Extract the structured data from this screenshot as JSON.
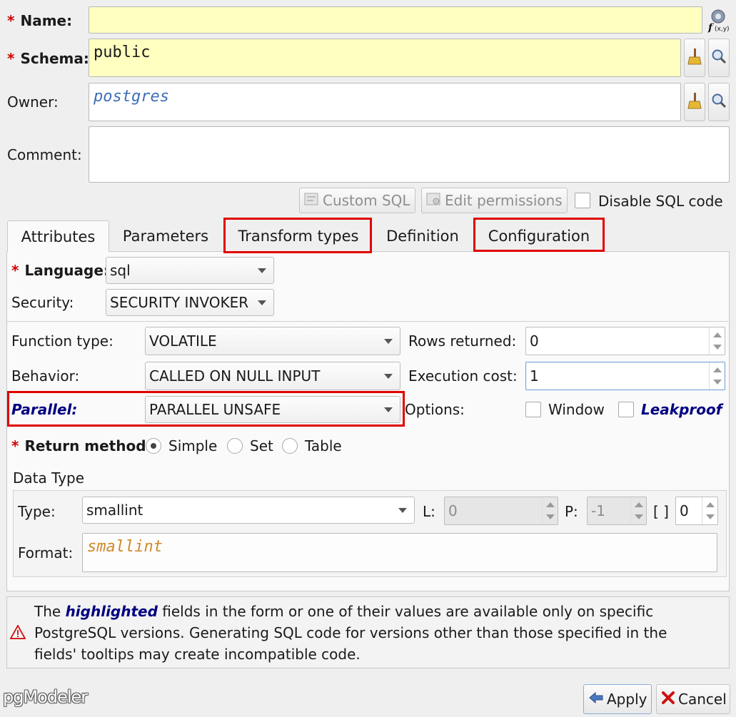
{
  "fields": {
    "name_label": "Name:",
    "name_value": "",
    "schema_label": "Schema:",
    "schema_value": "public",
    "owner_label": "Owner:",
    "owner_value": "postgres",
    "comment_label": "Comment:",
    "comment_value": "",
    "required_mark": "*"
  },
  "toolbar": {
    "custom_sql": "Custom SQL",
    "edit_permissions": "Edit permissions",
    "disable_sql": "Disable SQL code"
  },
  "tabs": [
    {
      "label": "Attributes"
    },
    {
      "label": "Parameters"
    },
    {
      "label": "Transform types"
    },
    {
      "label": "Definition"
    },
    {
      "label": "Configuration"
    }
  ],
  "attributes": {
    "language_label": "Language:",
    "language_value": "sql",
    "security_label": "Security:",
    "security_value": "SECURITY INVOKER",
    "function_type_label": "Function type:",
    "function_type_value": "VOLATILE",
    "rows_returned_label": "Rows returned:",
    "rows_returned_value": "0",
    "behavior_label": "Behavior:",
    "behavior_value": "CALLED ON NULL INPUT",
    "execution_cost_label": "Execution cost:",
    "execution_cost_value": "1",
    "parallel_label": "Parallel:",
    "parallel_value": "PARALLEL UNSAFE",
    "options_label": "Options:",
    "window_label": "Window",
    "leakproof_label": "Leakproof",
    "return_method_label": "Return method:",
    "return_simple": "Simple",
    "return_set": "Set",
    "return_table": "Table",
    "return_selected": "Simple"
  },
  "datatype": {
    "group_title": "Data Type",
    "type_label": "Type:",
    "type_value": "smallint",
    "l_label": "L:",
    "l_value": "0",
    "p_label": "P:",
    "p_value": "-1",
    "dim_label": "[ ]",
    "dim_value": "0",
    "format_label": "Format:",
    "format_value": "smallint"
  },
  "info": {
    "part1": "The ",
    "highlighted": "highlighted",
    "part2": " fields in the form or one of their values are available only on specific",
    "line2": "PostgreSQL versions. Generating SQL code for versions other than those specified in the",
    "line3": "fields' tooltips may create incompatible code."
  },
  "footer": {
    "logo": "pgModeler",
    "apply": "Apply",
    "cancel": "Cancel"
  },
  "colors": {
    "required": "#d00000",
    "highlight": "#000080",
    "redbox": "#e00000",
    "field_yellow": "#ffffc0"
  }
}
